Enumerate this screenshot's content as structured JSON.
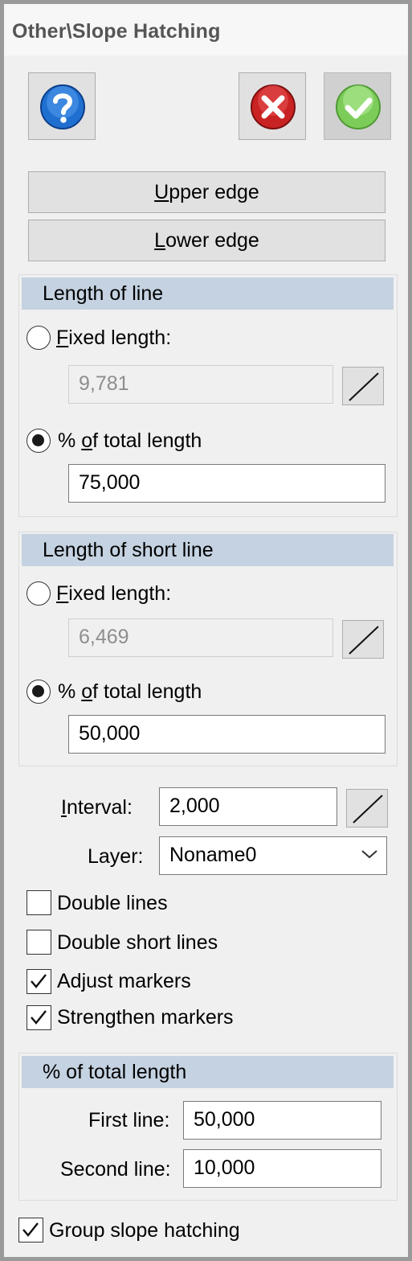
{
  "window": {
    "title": "Other\\Slope Hatching"
  },
  "toolbar": {
    "help_icon": "question-mark-icon",
    "cancel_icon": "red-x-icon",
    "ok_icon": "green-checkmark-icon"
  },
  "buttons": {
    "upper_edge": {
      "first": "U",
      "rest": "pper edge"
    },
    "lower_edge": {
      "first": "L",
      "rest": "ower edge"
    }
  },
  "length_of_line": {
    "title": "Length of line",
    "fixed_first": "F",
    "fixed_rest": "ixed length:",
    "fixed_value": "9,781",
    "percent_a": "% ",
    "percent_u": "o",
    "percent_b": "f total length",
    "percent_value": "75,000",
    "selected": "percent"
  },
  "length_of_short_line": {
    "title": "Length of short line",
    "fixed_first": "F",
    "fixed_rest": "ixed length:",
    "fixed_value": "6,469",
    "percent_a": "% ",
    "percent_u": "o",
    "percent_b": "f total length",
    "percent_value": "50,000",
    "selected": "percent"
  },
  "interval": {
    "label_first": "I",
    "label_rest": "nterval:",
    "value": "2,000"
  },
  "layer": {
    "label": "Layer:",
    "value": "Noname0"
  },
  "checkboxes": [
    {
      "label": "Double lines",
      "checked": false
    },
    {
      "label": "Double short lines",
      "checked": false
    },
    {
      "label": "Adjust markers",
      "checked": true
    },
    {
      "label": "Strengthen markers",
      "checked": true
    }
  ],
  "total_length": {
    "title": "% of total length",
    "first_label": "First line:",
    "first_value": "50,000",
    "second_label": "Second line:",
    "second_value": "10,000"
  },
  "group_slope_hatching": {
    "label": "Group slope hatching",
    "checked": true
  },
  "colors": {
    "panel_bg": "#f0f0f0",
    "group_header_bg": "#c4d2e1",
    "button_bg": "#e1e1e1",
    "help_blue": "#1f6fd0",
    "cancel_red": "#d42a2a",
    "ok_green": "#7ccc5a"
  }
}
